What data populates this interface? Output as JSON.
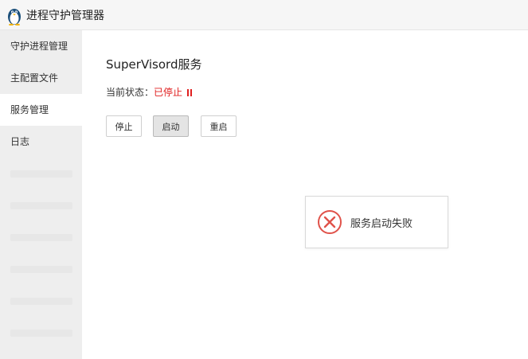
{
  "app": {
    "title": "进程守护管理器"
  },
  "sidebar": {
    "items": [
      {
        "label": "守护进程管理",
        "active": false
      },
      {
        "label": "主配置文件",
        "active": false
      },
      {
        "label": "服务管理",
        "active": true
      },
      {
        "label": "日志",
        "active": false
      }
    ]
  },
  "main": {
    "title": "SuperVisord服务",
    "status_label": "当前状态：",
    "status_value": "已停止",
    "status_color": "#e02020",
    "buttons": {
      "stop": "停止",
      "start": "启动",
      "restart": "重启"
    }
  },
  "toast": {
    "icon": "error-circle-x-icon",
    "icon_color": "#e0524a",
    "message": "服务启动失败"
  }
}
